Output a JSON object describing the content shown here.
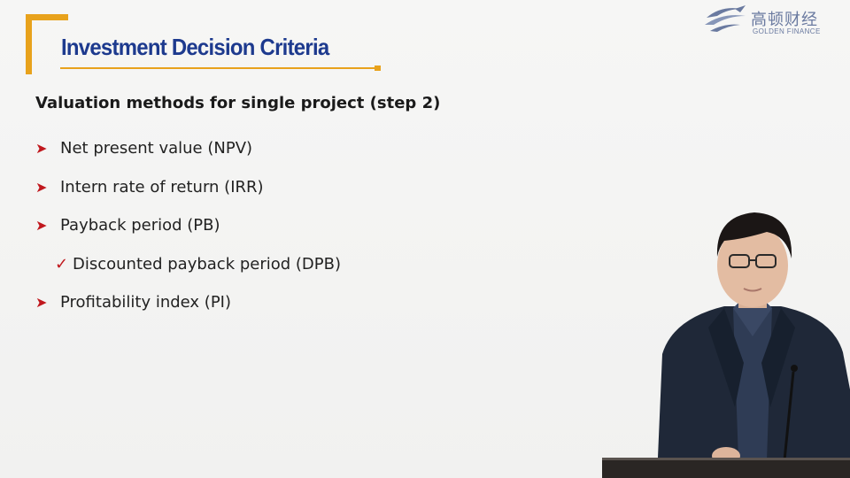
{
  "slide": {
    "title": "Investment Decision Criteria",
    "subtitle": "Valuation methods for single project (step 2)",
    "items": [
      {
        "marker": "arrow-bullet-icon",
        "label": "Net present value (NPV)",
        "level": 1
      },
      {
        "marker": "arrow-bullet-icon",
        "label": "Intern rate of return (IRR)",
        "level": 1
      },
      {
        "marker": "arrow-bullet-icon",
        "label": "Payback period (PB)",
        "level": 1
      },
      {
        "marker": "checkmark-icon",
        "label": "Discounted payback period (DPB)",
        "level": 2
      },
      {
        "marker": "arrow-bullet-icon",
        "label": "Profitability index (PI)",
        "level": 1
      }
    ]
  },
  "logo": {
    "chinese_name": "高顿财经",
    "english_name": "GOLDEN FINANCE"
  },
  "colors": {
    "title": "#1d3a8e",
    "accent": "#e8a21c",
    "bullet": "#c0171d",
    "logo": "#6a7aa0"
  }
}
